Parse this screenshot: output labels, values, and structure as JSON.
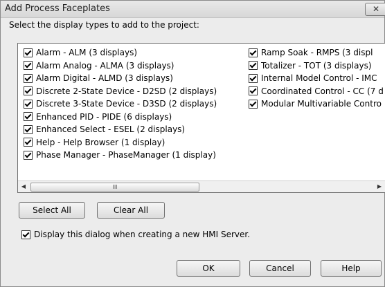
{
  "dialog": {
    "title": "Add Process Faceplates",
    "close_label": "✕",
    "instruction": "Select the display types to add to the project:",
    "list_left": [
      "Alarm - ALM (3 displays)",
      "Alarm Analog - ALMA (3 displays)",
      "Alarm Digital - ALMD (3 displays)",
      "Discrete 2-State Device - D2SD (2 displays)",
      "Discrete 3-State Device - D3SD (2 displays)",
      "Enhanced PID - PIDE (6 displays)",
      "Enhanced Select - ESEL (2 displays)",
      "Help - Help Browser (1 display)",
      "Phase Manager - PhaseManager (1 display)"
    ],
    "list_right": [
      "Ramp Soak - RMPS (3 displ",
      "Totalizer - TOT (3 displays)",
      "Internal Model Control - IMC",
      "Coordinated Control - CC (7 d",
      "Modular Multivariable Contro"
    ],
    "scroll_thumb": "III",
    "select_all": "Select All",
    "clear_all": "Clear All",
    "show_dialog_label": "Display this dialog when creating a new HMI Server.",
    "ok": "OK",
    "cancel": "Cancel",
    "help": "Help"
  }
}
